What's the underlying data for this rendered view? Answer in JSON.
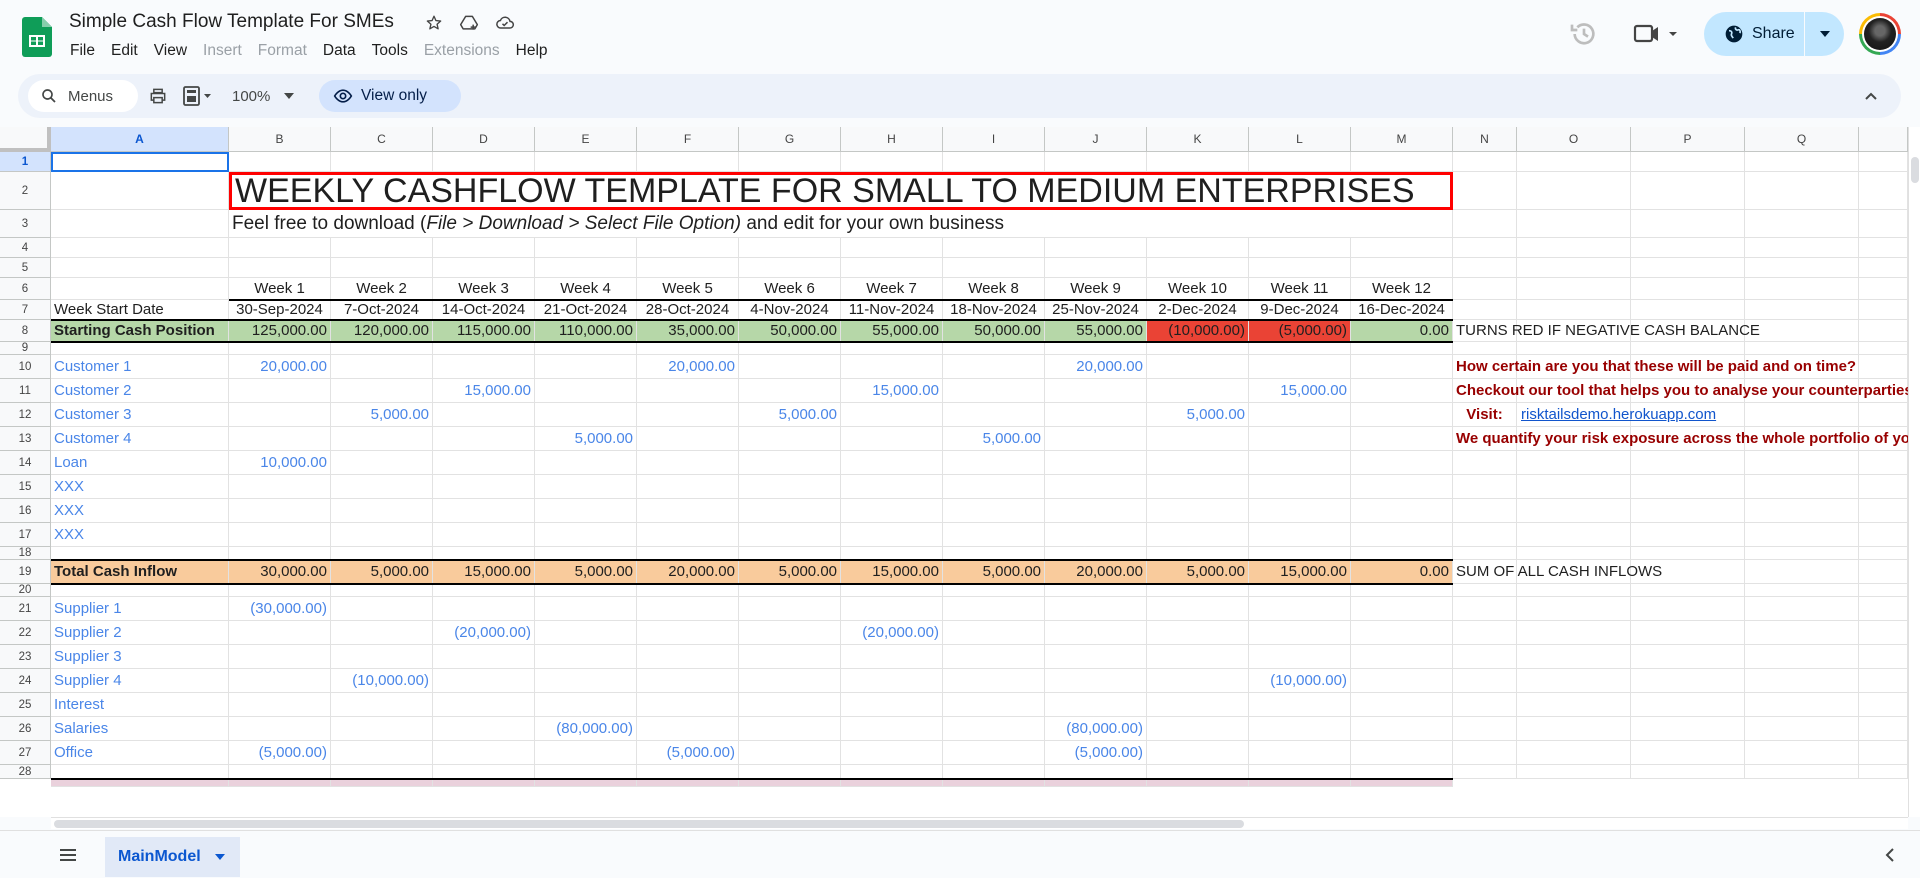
{
  "app": {
    "title": "Simple Cash Flow Template For SMEs",
    "menu": [
      {
        "label": "File",
        "disabled": false
      },
      {
        "label": "Edit",
        "disabled": false
      },
      {
        "label": "View",
        "disabled": false
      },
      {
        "label": "Insert",
        "disabled": true
      },
      {
        "label": "Format",
        "disabled": true
      },
      {
        "label": "Data",
        "disabled": false
      },
      {
        "label": "Tools",
        "disabled": false
      },
      {
        "label": "Extensions",
        "disabled": true
      },
      {
        "label": "Help",
        "disabled": false
      }
    ],
    "share_label": "Share"
  },
  "toolbar": {
    "menus_label": "Menus",
    "zoom": "100%",
    "view_only_label": "View only"
  },
  "grid": {
    "columns": [
      "A",
      "B",
      "C",
      "D",
      "E",
      "F",
      "G",
      "H",
      "I",
      "J",
      "K",
      "L",
      "M",
      "N",
      "O",
      "P",
      "Q"
    ],
    "selected_column": "A",
    "rows": [
      "1",
      "2",
      "3",
      "4",
      "5",
      "6",
      "7",
      "8",
      "9",
      "10",
      "11",
      "12",
      "13",
      "14",
      "15",
      "16",
      "17",
      "18",
      "19",
      "20",
      "21",
      "22",
      "23",
      "24",
      "25",
      "26",
      "27",
      "28"
    ],
    "selected_row": "1",
    "title_cell": "WEEKLY CASHFLOW TEMPLATE FOR SMALL TO MEDIUM ENTERPRISES",
    "subtitle": {
      "pre": "Feel free to download (",
      "italic": "File > Download > Select File Option)",
      "post": " and edit for your own business"
    },
    "weeks": [
      "Week 1",
      "Week 2",
      "Week 3",
      "Week 4",
      "Week 5",
      "Week 6",
      "Week 7",
      "Week 8",
      "Week 9",
      "Week 10",
      "Week 11",
      "Week 12"
    ],
    "week_start_label": "Week Start Date",
    "week_start_dates": [
      "30-Sep-2024",
      "7-Oct-2024",
      "14-Oct-2024",
      "21-Oct-2024",
      "28-Oct-2024",
      "4-Nov-2024",
      "11-Nov-2024",
      "18-Nov-2024",
      "25-Nov-2024",
      "2-Dec-2024",
      "9-Dec-2024",
      "16-Dec-2024"
    ],
    "starting_cash": {
      "label": "Starting Cash Position",
      "values": [
        "125,000.00",
        "120,000.00",
        "115,000.00",
        "110,000.00",
        "35,000.00",
        "50,000.00",
        "55,000.00",
        "50,000.00",
        "55,000.00",
        "(10,000.00)",
        "(5,000.00)",
        "0.00"
      ],
      "negative": [
        false,
        false,
        false,
        false,
        false,
        false,
        false,
        false,
        false,
        true,
        true,
        false
      ],
      "note": "TURNS RED IF NEGATIVE CASH BALANCE",
      "positive_color": "#b6d7a8",
      "negative_color": "#ea4335"
    },
    "inflows": [
      {
        "label": "Customer 1",
        "values": [
          "20,000.00",
          "",
          "",
          "",
          "20,000.00",
          "",
          "",
          "",
          "20,000.00",
          "",
          "",
          ""
        ]
      },
      {
        "label": "Customer 2",
        "values": [
          "",
          "",
          "15,000.00",
          "",
          "",
          "",
          "15,000.00",
          "",
          "",
          "",
          "15,000.00",
          ""
        ]
      },
      {
        "label": "Customer 3",
        "values": [
          "",
          "5,000.00",
          "",
          "",
          "",
          "5,000.00",
          "",
          "",
          "",
          "5,000.00",
          "",
          ""
        ]
      },
      {
        "label": "Customer 4",
        "values": [
          "",
          "",
          "",
          "5,000.00",
          "",
          "",
          "",
          "5,000.00",
          "",
          "",
          "",
          ""
        ]
      },
      {
        "label": "Loan",
        "values": [
          "10,000.00",
          "",
          "",
          "",
          "",
          "",
          "",
          "",
          "",
          "",
          "",
          ""
        ]
      },
      {
        "label": "XXX",
        "values": [
          "",
          "",
          "",
          "",
          "",
          "",
          "",
          "",
          "",
          "",
          "",
          ""
        ]
      },
      {
        "label": "XXX",
        "values": [
          "",
          "",
          "",
          "",
          "",
          "",
          "",
          "",
          "",
          "",
          "",
          ""
        ]
      },
      {
        "label": "XXX",
        "values": [
          "",
          "",
          "",
          "",
          "",
          "",
          "",
          "",
          "",
          "",
          "",
          ""
        ]
      }
    ],
    "promo": {
      "line1": "How certain are you that these will be paid and on time?",
      "line2": "Checkout our tool that helps you to analyse your counterparties",
      "visit_label": "Visit:",
      "link": "risktailsdemo.herokuapp.com",
      "line4": "We quantify your risk exposure across the whole portfolio of your"
    },
    "total_inflow": {
      "label": "Total Cash Inflow",
      "values": [
        "30,000.00",
        "5,000.00",
        "15,000.00",
        "5,000.00",
        "20,000.00",
        "5,000.00",
        "15,000.00",
        "5,000.00",
        "20,000.00",
        "5,000.00",
        "15,000.00",
        "0.00"
      ],
      "note": "SUM OF ALL CASH INFLOWS",
      "color": "#f9cb9c"
    },
    "outflows": [
      {
        "label": "Supplier 1",
        "values": [
          "(30,000.00)",
          "",
          "",
          "",
          "",
          "",
          "",
          "",
          "",
          "",
          "",
          ""
        ]
      },
      {
        "label": "Supplier 2",
        "values": [
          "",
          "",
          "(20,000.00)",
          "",
          "",
          "",
          "(20,000.00)",
          "",
          "",
          "",
          "",
          ""
        ]
      },
      {
        "label": "Supplier 3",
        "values": [
          "",
          "",
          "",
          "",
          "",
          "",
          "",
          "",
          "",
          "",
          "",
          ""
        ]
      },
      {
        "label": "Supplier 4",
        "values": [
          "",
          "(10,000.00)",
          "",
          "",
          "",
          "",
          "",
          "",
          "",
          "",
          "(10,000.00)",
          ""
        ]
      },
      {
        "label": "Interest",
        "values": [
          "",
          "",
          "",
          "",
          "",
          "",
          "",
          "",
          "",
          "",
          "",
          ""
        ]
      },
      {
        "label": "Salaries",
        "values": [
          "",
          "",
          "",
          "(80,000.00)",
          "",
          "",
          "",
          "",
          "(80,000.00)",
          "",
          "",
          ""
        ]
      },
      {
        "label": "Office",
        "values": [
          "(5,000.00)",
          "",
          "",
          "",
          "(5,000.00)",
          "",
          "",
          "",
          "(5,000.00)",
          "",
          "",
          ""
        ]
      }
    ]
  },
  "sheets": {
    "active": "MainModel"
  }
}
